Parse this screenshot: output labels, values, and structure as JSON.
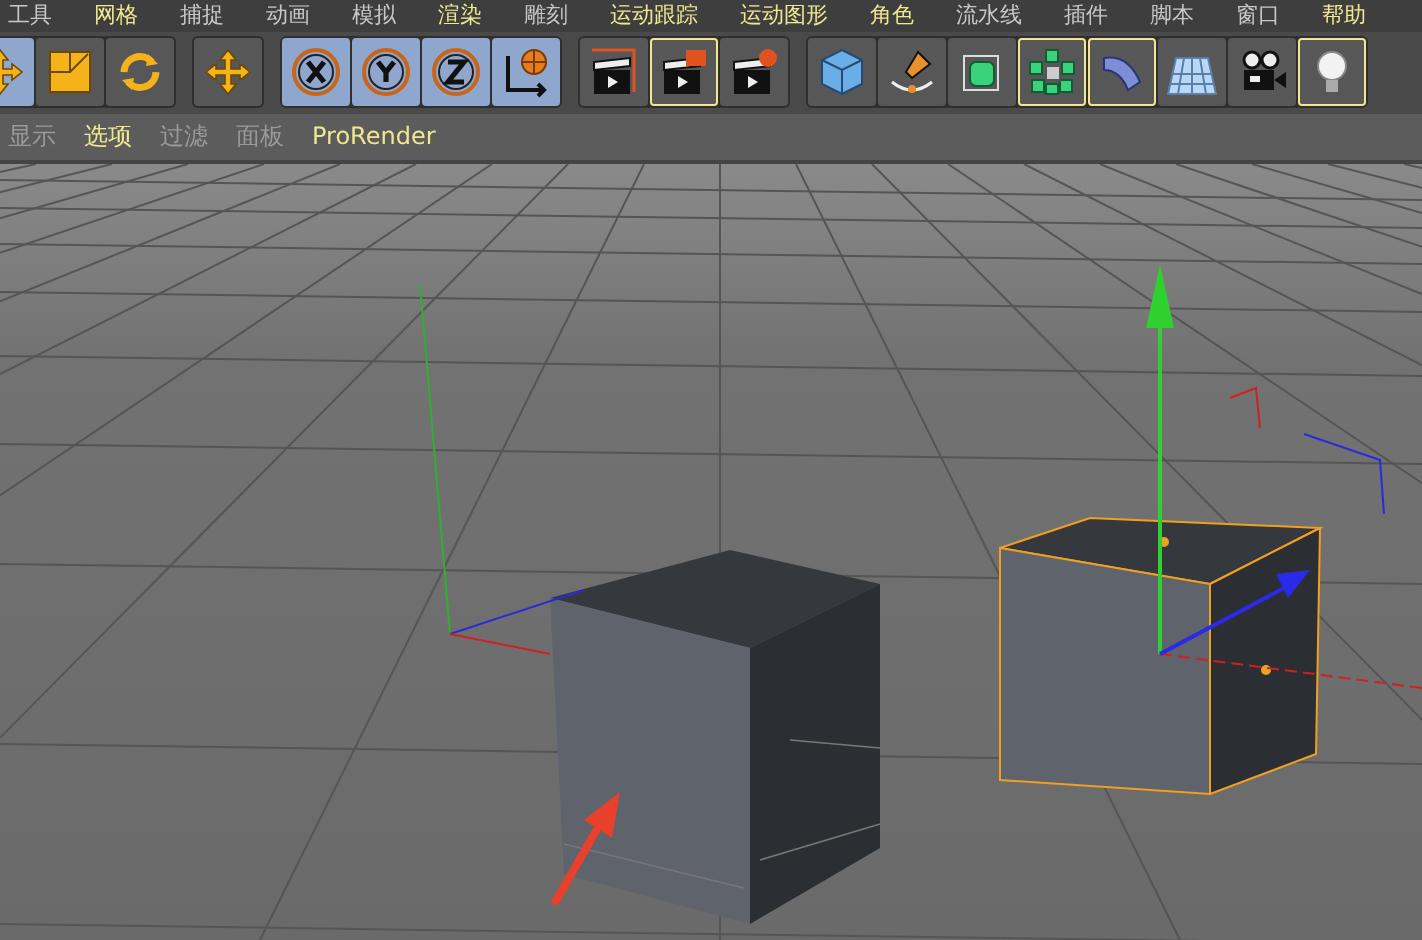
{
  "menu_bar": [
    {
      "label": "工具",
      "highlighted": false
    },
    {
      "label": "网格",
      "highlighted": true
    },
    {
      "label": "捕捉",
      "highlighted": false
    },
    {
      "label": "动画",
      "highlighted": false
    },
    {
      "label": "模拟",
      "highlighted": false
    },
    {
      "label": "渲染",
      "highlighted": true
    },
    {
      "label": "雕刻",
      "highlighted": false
    },
    {
      "label": "运动跟踪",
      "highlighted": true
    },
    {
      "label": "运动图形",
      "highlighted": true
    },
    {
      "label": "角色",
      "highlighted": true
    },
    {
      "label": "流水线",
      "highlighted": false
    },
    {
      "label": "插件",
      "highlighted": false
    },
    {
      "label": "脚本",
      "highlighted": false
    },
    {
      "label": "窗口",
      "highlighted": false
    },
    {
      "label": "帮助",
      "highlighted": true
    }
  ],
  "toolbar_groups": [
    [
      {
        "kind": "move",
        "active": true,
        "highlighted": false
      },
      {
        "kind": "scale",
        "active": false,
        "highlighted": false
      },
      {
        "kind": "rotate",
        "active": false,
        "highlighted": false
      }
    ],
    [
      {
        "kind": "move",
        "active": false,
        "highlighted": false
      }
    ],
    [
      {
        "kind": "axis-x",
        "active": true,
        "highlighted": false
      },
      {
        "kind": "axis-y",
        "active": true,
        "highlighted": false
      },
      {
        "kind": "axis-z",
        "active": true,
        "highlighted": false
      },
      {
        "kind": "world",
        "active": true,
        "highlighted": false
      }
    ],
    [
      {
        "kind": "render-view",
        "active": false,
        "highlighted": false
      },
      {
        "kind": "render",
        "active": false,
        "highlighted": true
      },
      {
        "kind": "render-settings",
        "active": false,
        "highlighted": false
      }
    ],
    [
      {
        "kind": "cube",
        "active": false,
        "highlighted": false
      },
      {
        "kind": "pen",
        "active": false,
        "highlighted": false
      },
      {
        "kind": "subdivision",
        "active": false,
        "highlighted": false
      },
      {
        "kind": "cloner",
        "active": false,
        "highlighted": true
      },
      {
        "kind": "bend",
        "active": false,
        "highlighted": true
      },
      {
        "kind": "floor",
        "active": false,
        "highlighted": false
      },
      {
        "kind": "camera",
        "active": false,
        "highlighted": false
      },
      {
        "kind": "light",
        "active": false,
        "highlighted": true
      }
    ]
  ],
  "viewport_menu": [
    {
      "label": "显示",
      "highlighted": false
    },
    {
      "label": "选项",
      "highlighted": true
    },
    {
      "label": "过滤",
      "highlighted": false
    },
    {
      "label": "面板",
      "highlighted": false
    },
    {
      "label": "ProRender",
      "highlighted": true
    }
  ]
}
